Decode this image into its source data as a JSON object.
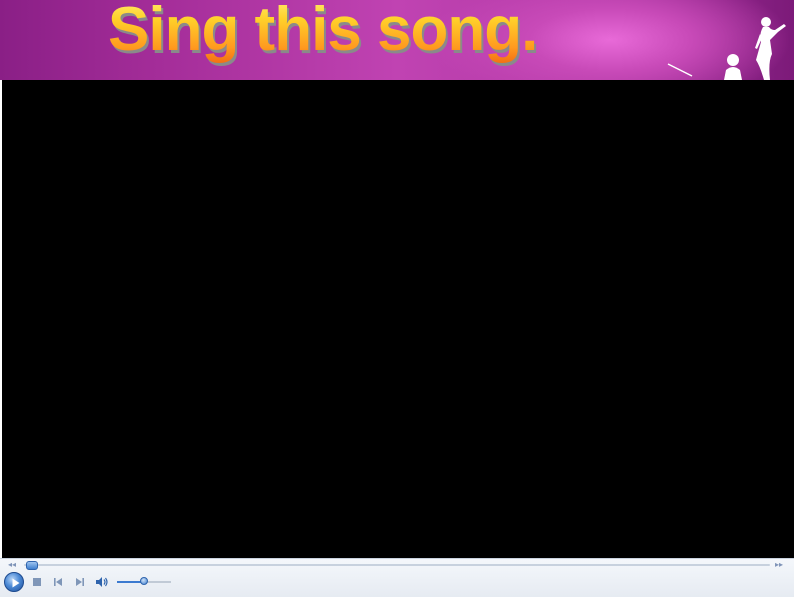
{
  "slide": {
    "title": "Sing this song."
  },
  "player": {
    "seek_position": 0.0,
    "volume_level": 0.5,
    "icons": {
      "rewind": "rewind-icon",
      "fast_forward": "fast-forward-icon",
      "play": "play-icon",
      "stop": "stop-icon",
      "previous": "previous-track-icon",
      "next": "next-track-icon",
      "volume": "speaker-icon"
    }
  },
  "colors": {
    "banner": "#b43aa8",
    "title_top": "#fff27a",
    "title_bottom": "#f36a12",
    "video_bg": "#000000",
    "accent": "#3f7fcf"
  }
}
